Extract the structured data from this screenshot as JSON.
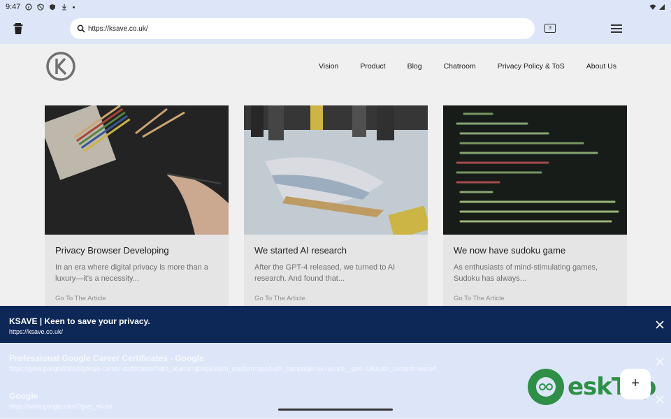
{
  "status": {
    "time": "9:47"
  },
  "browser": {
    "url": "https://ksave.co.uk/",
    "tab_count": "3"
  },
  "site": {
    "nav": [
      "Vision",
      "Product",
      "Blog",
      "Chatroom",
      "Privacy Policy & ToS",
      "About Us"
    ],
    "cards": [
      {
        "title": "Privacy Browser Developing",
        "excerpt": "In an era where digital privacy is more than a luxury—it's a necessity...",
        "link": "Go To The Article"
      },
      {
        "title": "We started AI research",
        "excerpt": "After the GPT-4 released, we turned to AI research. And found that...",
        "link": "Go To The Article"
      },
      {
        "title": "We now have sudoku game",
        "excerpt": "As enthusiasts of mind-stimulating games, Sudoku has always...",
        "link": "Go To The Article"
      }
    ]
  },
  "popup": {
    "title": "KSAVE | Keen to save your privacy.",
    "url": "https://ksave.co.uk/"
  },
  "suggestions": [
    {
      "title": "Professional Google Career Certificates - Google",
      "url": "https://grow.google/intl/uk/google-career-certificates/?utm_source=google&utm_medium=ppp&utm_campaign=uk-launch__geo--UK&utm_content=owned"
    },
    {
      "title": "Google",
      "url": "https://www.google.com/?gws_rd=ssl"
    }
  ],
  "fab": {
    "label": "+"
  },
  "watermark": {
    "text": "eskTop"
  }
}
